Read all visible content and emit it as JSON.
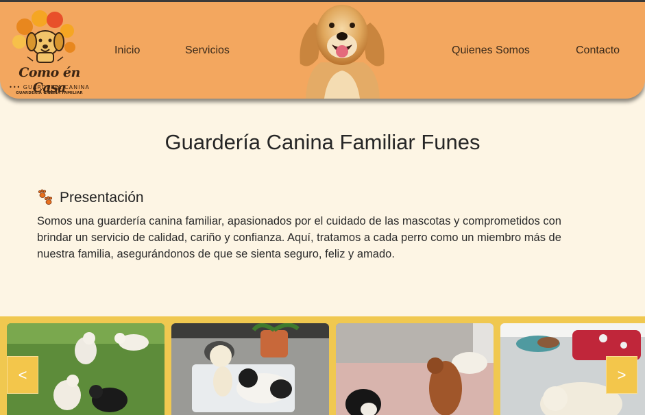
{
  "brand": {
    "name": "Como én Casa",
    "tagline": "••• GUARDERIA CANINA •••",
    "subtagline": "GUARDERÍA CANINA FAMILIAR"
  },
  "nav": {
    "items": [
      {
        "label": "Inicio"
      },
      {
        "label": "Servicios"
      },
      {
        "label": "Quienes Somos"
      },
      {
        "label": "Contacto"
      }
    ]
  },
  "colors": {
    "header": "#f3a75f",
    "page_bg": "#fdf5e4",
    "gallery_bg": "#f0c850",
    "arrow_bg": "#f3c64b"
  },
  "main": {
    "title": "Guardería Canina Familiar Funes",
    "section_icon": "paw-prints-icon",
    "section_title": "Presentación",
    "section_text": "Somos una guardería canina familiar, apasionados por el cuidado de las mascotas y comprometidos con brindar un servicio de calidad, cariño y confianza. Aquí, tratamos a cada perro como un miembro más de nuestra familia, asegurándonos de que se sienta seguro, feliz y amado."
  },
  "gallery": {
    "prev_label": "<",
    "next_label": ">",
    "photos": [
      {
        "icon": "dogs-on-grass-photo"
      },
      {
        "icon": "dogs-on-blanket-photo"
      },
      {
        "icon": "dogs-on-bed-photo"
      },
      {
        "icon": "dogs-resting-photo"
      }
    ]
  }
}
